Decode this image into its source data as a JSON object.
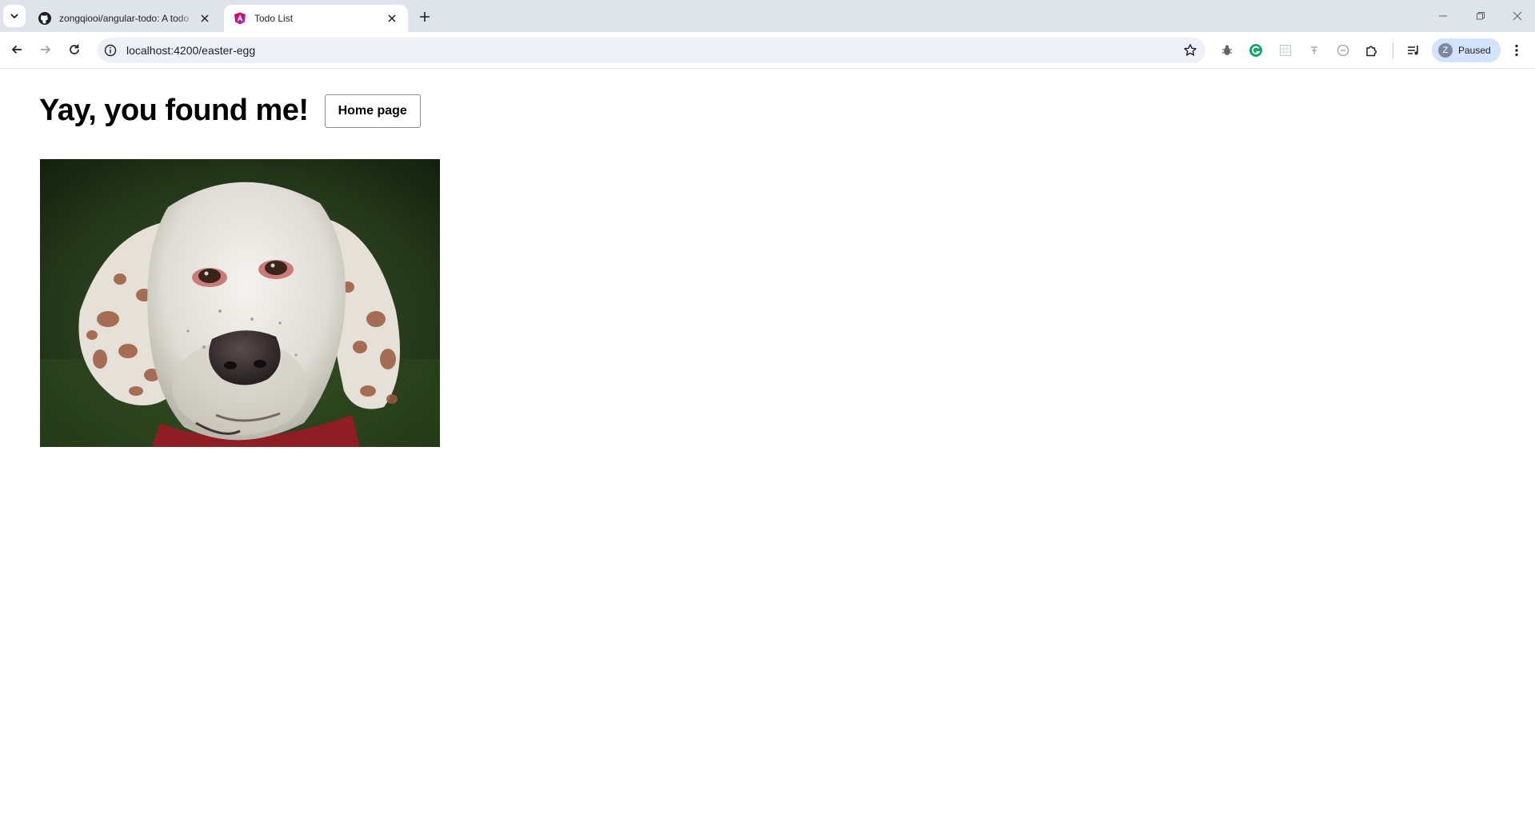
{
  "browser": {
    "tabs": [
      {
        "title": "zongqiooi/angular-todo: A todo",
        "active": false,
        "favicon": "github-icon"
      },
      {
        "title": "Todo List",
        "active": true,
        "favicon": "angular-icon"
      }
    ],
    "url": "localhost:4200/easter-egg",
    "profile": {
      "initial": "Z",
      "status": "Paused"
    }
  },
  "page": {
    "heading": "Yay, you found me!",
    "home_button": "Home page",
    "image": {
      "subject": "dog-photo"
    }
  },
  "colors": {
    "tabstrip": "#dfe3ea",
    "omnibox": "#edf1f7",
    "profile_chip": "#d3e3fd",
    "grammarly": "#15a56b"
  }
}
